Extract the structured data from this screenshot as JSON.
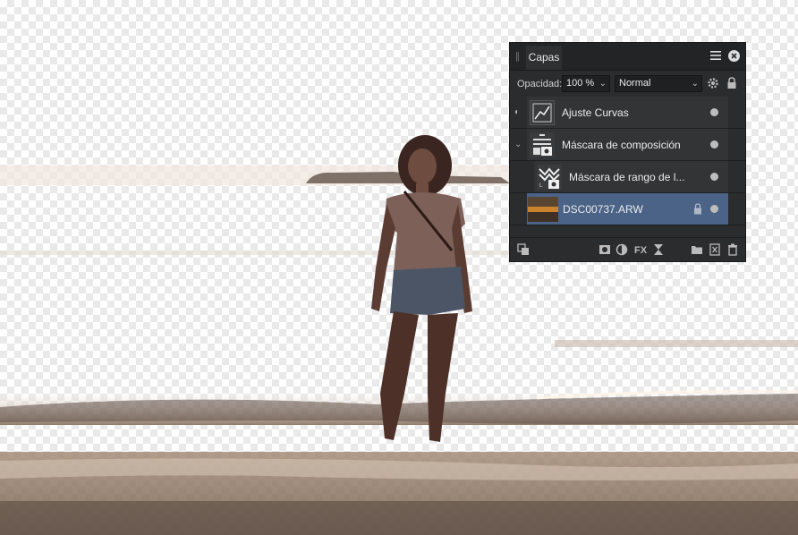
{
  "panel": {
    "tab_label": "Capas",
    "opacity_label": "Opacidad:",
    "opacity_value": "100 %",
    "blend_mode": "Normal",
    "chevron": "⌄"
  },
  "layers": [
    {
      "name": "Ajuste Curvas",
      "icon": "curves-adjustment-icon",
      "selected": false
    },
    {
      "name": "Máscara de composición",
      "icon": "compositing-mask-icon",
      "selected": false,
      "expanded": true
    },
    {
      "name": "Máscara de rango de l...",
      "icon": "luminosity-range-mask-icon",
      "selected": false,
      "child": true
    },
    {
      "name": "DSC00737.ARW",
      "icon": "pixel-layer-thumbnail",
      "selected": true,
      "locked": true
    }
  ],
  "colors": {
    "panel_bg": "#2b2c2e",
    "selected_row": "#4a6386"
  }
}
